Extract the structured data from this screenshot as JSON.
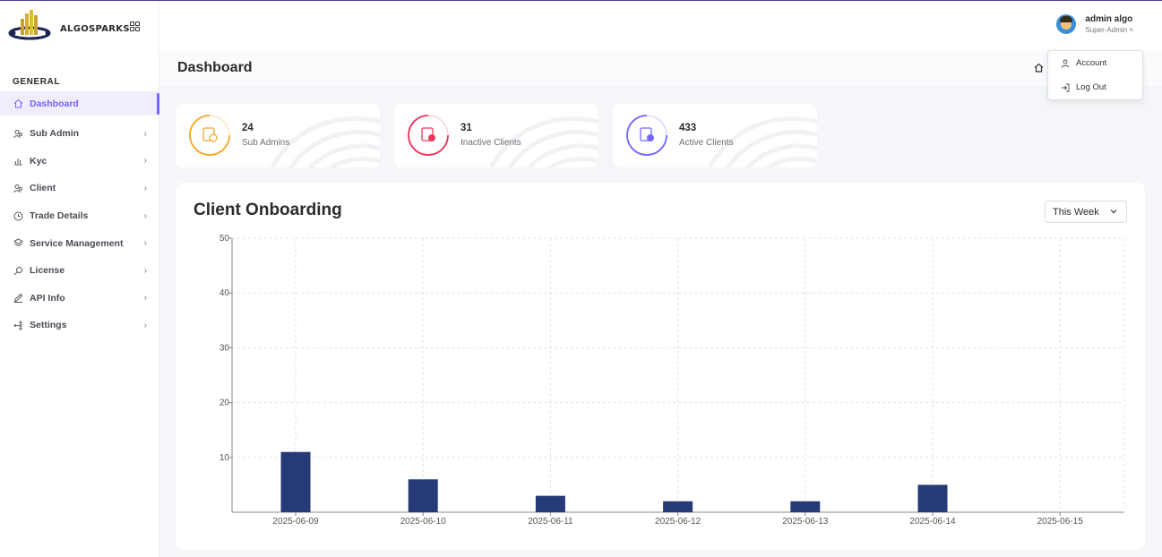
{
  "brand": {
    "name": "ALGOSPARKS"
  },
  "sidebar": {
    "section": "GENERAL",
    "items": [
      {
        "label": "Dashboard",
        "icon": "home-icon",
        "active": true,
        "has_children": false
      },
      {
        "label": "Sub Admin",
        "icon": "users-icon",
        "active": false,
        "has_children": true
      },
      {
        "label": "Kyc",
        "icon": "chart-icon",
        "active": false,
        "has_children": true
      },
      {
        "label": "Client",
        "icon": "users-icon",
        "active": false,
        "has_children": true
      },
      {
        "label": "Trade Details",
        "icon": "clock-icon",
        "active": false,
        "has_children": true
      },
      {
        "label": "Service Management",
        "icon": "layers-icon",
        "active": false,
        "has_children": true
      },
      {
        "label": "License",
        "icon": "key-icon",
        "active": false,
        "has_children": true
      },
      {
        "label": "API Info",
        "icon": "pen-icon",
        "active": false,
        "has_children": true
      },
      {
        "label": "Settings",
        "icon": "settings-icon",
        "active": false,
        "has_children": true
      }
    ]
  },
  "header": {
    "user_name": "admin algo",
    "user_role": "Super-Admin"
  },
  "user_menu": {
    "account": "Account",
    "logout": "Log Out"
  },
  "page": {
    "title": "Dashboard"
  },
  "stats": [
    {
      "value": "24",
      "label": "Sub Admins",
      "color": "#f3a826"
    },
    {
      "value": "31",
      "label": "Inactive Clients",
      "color": "#e8385f"
    },
    {
      "value": "433",
      "label": "Active Clients",
      "color": "#7366ff"
    }
  ],
  "chart_panel": {
    "title": "Client Onboarding",
    "range_selected": "This Week"
  },
  "chart_data": {
    "type": "bar",
    "categories": [
      "2025-06-09",
      "2025-06-10",
      "2025-06-11",
      "2025-06-12",
      "2025-06-13",
      "2025-06-14",
      "2025-06-15"
    ],
    "values": [
      11,
      6,
      3,
      2,
      2,
      5,
      0
    ],
    "ylim": [
      0,
      50
    ],
    "yticks": [
      10,
      20,
      30,
      40,
      50
    ],
    "bar_color": "#263a78",
    "grid": true
  }
}
